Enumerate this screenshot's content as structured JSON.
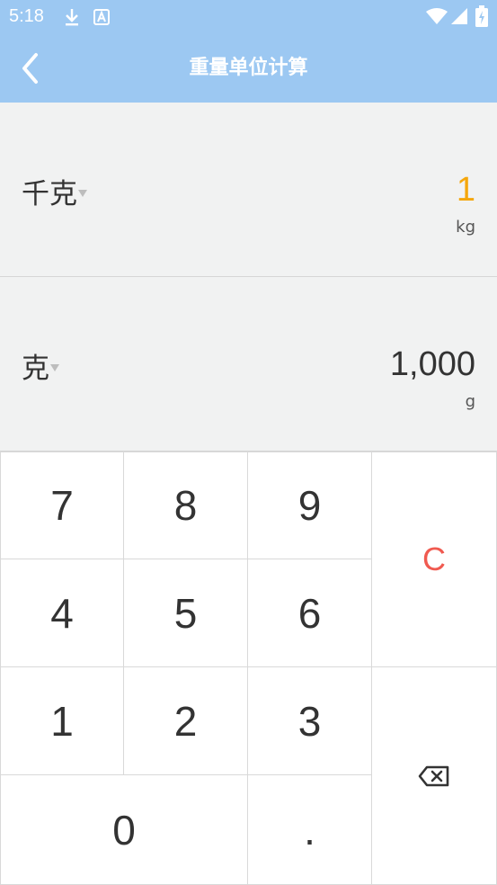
{
  "status_bar": {
    "time": "5:18",
    "icons": [
      "download-icon",
      "a-notification-icon",
      "wifi-icon",
      "signal-icon",
      "battery-icon"
    ]
  },
  "app_bar": {
    "title": "重量单位计算",
    "background_color": "#9cc8f2"
  },
  "converter": {
    "from": {
      "unit_name": "千克",
      "value": "1",
      "symbol": "kg",
      "value_color": "#f5a70c"
    },
    "to": {
      "unit_name": "克",
      "value": "1,000",
      "symbol": "g"
    }
  },
  "keypad": {
    "keys": {
      "seven": "7",
      "eight": "8",
      "nine": "9",
      "four": "4",
      "five": "5",
      "six": "6",
      "one": "1",
      "two": "2",
      "three": "3",
      "zero": "0",
      "dot": ".",
      "clear": "C"
    },
    "clear_color": "#f05a50"
  }
}
